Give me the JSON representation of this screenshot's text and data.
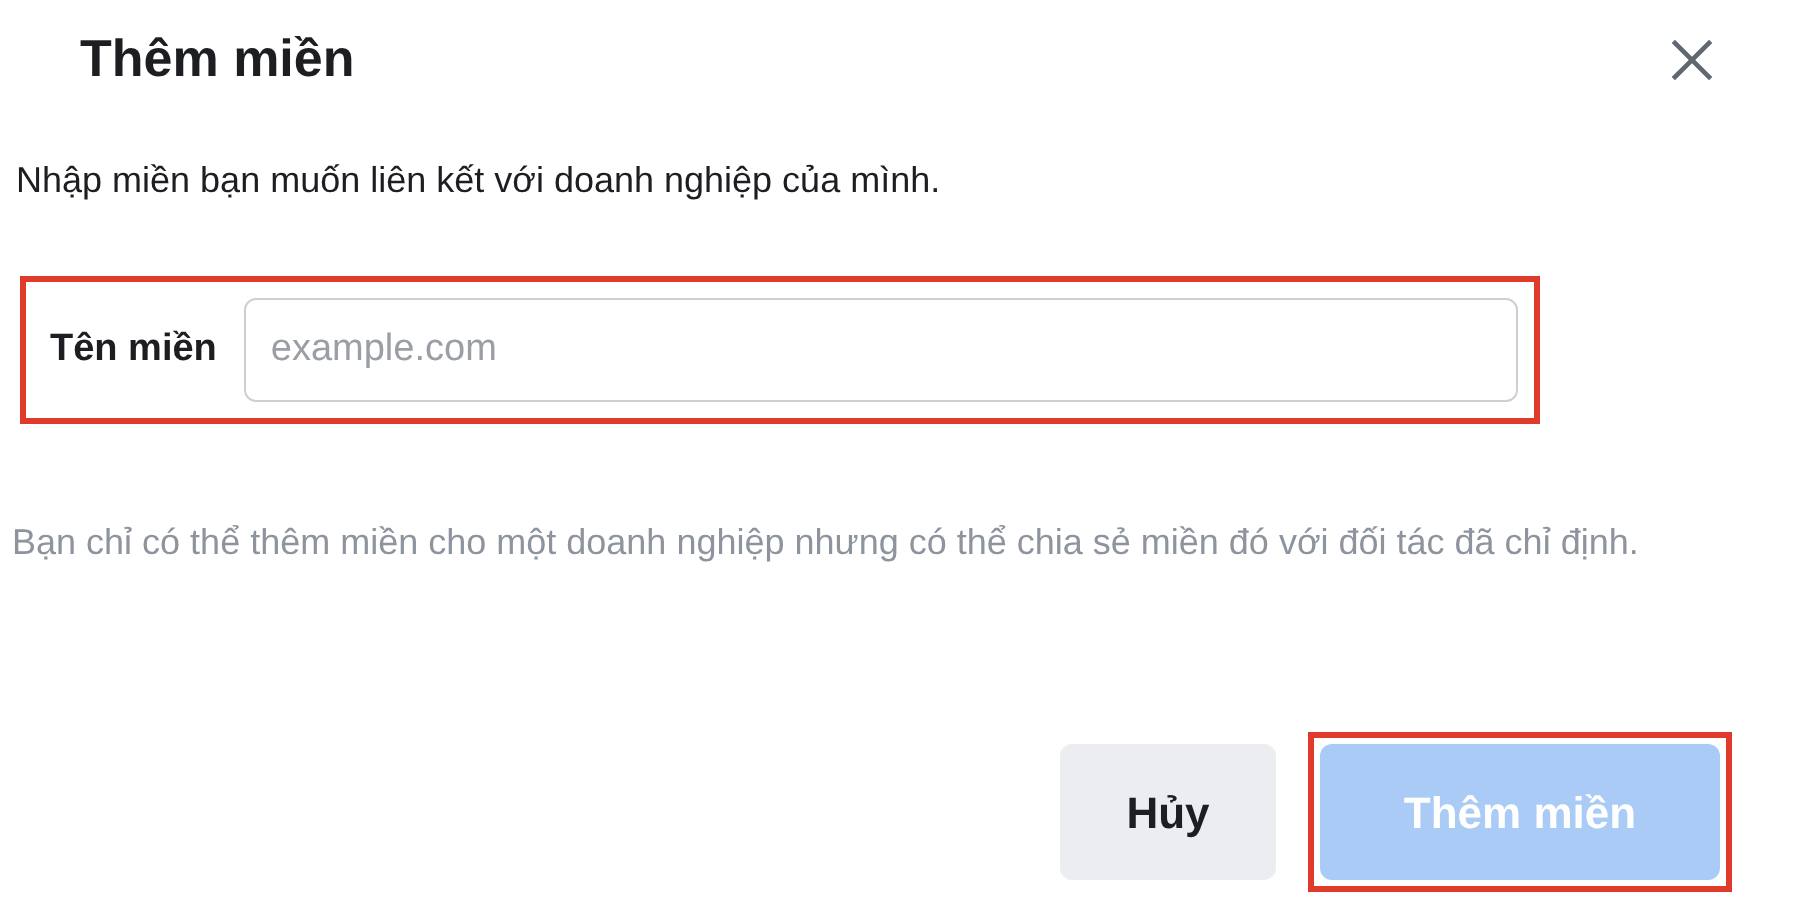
{
  "dialog": {
    "title": "Thêm miền",
    "description": "Nhập miền bạn muốn liên kết với doanh nghiệp của mình."
  },
  "field": {
    "label": "Tên miền",
    "placeholder": "example.com",
    "highlighted": true
  },
  "help": "Bạn chỉ có thể thêm miền cho một doanh nghiệp nhưng có thể chia sẻ miền đó với đối tác đã chỉ định.",
  "buttons": [
    {
      "label": "Hủy",
      "kind": "secondary",
      "disabled": false,
      "highlighted": false
    },
    {
      "label": "Thêm miền",
      "kind": "primary",
      "disabled": true,
      "highlighted": true
    }
  ]
}
